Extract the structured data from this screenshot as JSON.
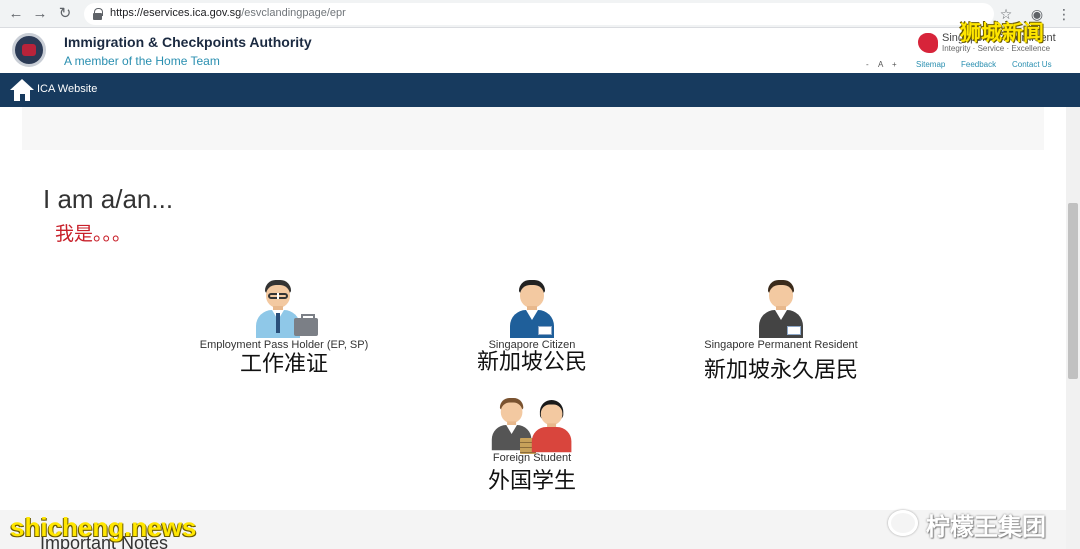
{
  "browser": {
    "url_host": "https://eservices.ica.gov.sg",
    "url_path": "/esvclandingpage/epr"
  },
  "header": {
    "org_title": "Immigration & Checkpoints Authority",
    "org_subtitle": "A member of the Home Team",
    "sg_brand": "Singapore Government",
    "sg_tagline": "Integrity · Service · Excellence",
    "font_decrease": "-",
    "font_label": "A",
    "font_increase": "+",
    "links": [
      "Sitemap",
      "Feedback",
      "Contact Us"
    ]
  },
  "nav": {
    "home_label": "ICA Website"
  },
  "main": {
    "heading": "I am a/an...",
    "heading_cn": "我是。。。",
    "options": [
      {
        "label": "Employment Pass Holder (EP, SP)",
        "label_cn": "工作准证",
        "icon": "employee-with-briefcase-icon"
      },
      {
        "label": "Singapore Citizen",
        "label_cn": "新加坡公民",
        "icon": "citizen-icon"
      },
      {
        "label": "Singapore Permanent Resident",
        "label_cn": "新加坡永久居民",
        "icon": "permanent-resident-icon"
      },
      {
        "label": "Foreign Student",
        "label_cn": "外国学生",
        "icon": "students-icon"
      }
    ],
    "notes_title": "Important Notes"
  },
  "watermarks": {
    "top_right": "狮城新闻",
    "bottom_left": "shicheng.news",
    "bottom_right": "柠檬王集团"
  },
  "colors": {
    "nav_bg": "#173a5e",
    "brand_link": "#2a8fb0",
    "heading_cn": "#c8202a"
  }
}
